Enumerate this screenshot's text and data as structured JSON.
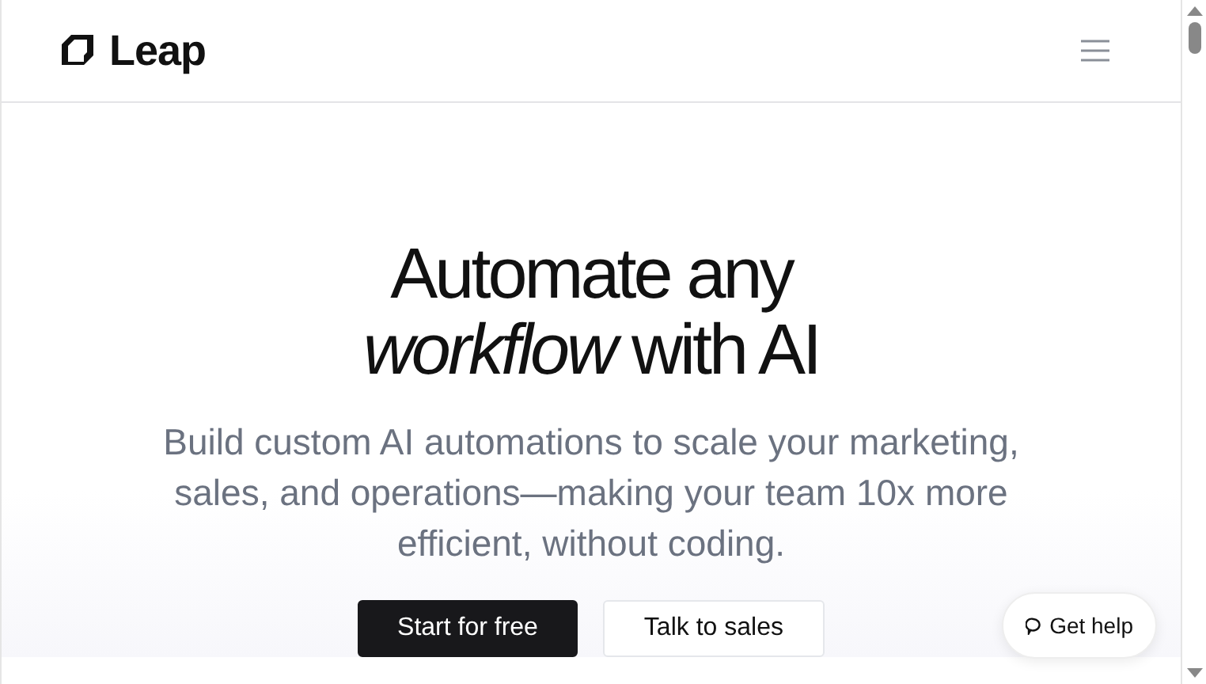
{
  "header": {
    "logo": "Leap"
  },
  "hero": {
    "headline": "Automate any *workflow* with AI",
    "subtitle": "Build custom AI automations to scale your marketing, sales, and operations—making your team 10x more efficient, without coding.",
    "buttons": [
      {
        "label": "Start for free",
        "kind": "primary"
      },
      {
        "label": "Talk to sales",
        "kind": "secondary"
      }
    ]
  },
  "help_button": {
    "label": "Get help"
  }
}
